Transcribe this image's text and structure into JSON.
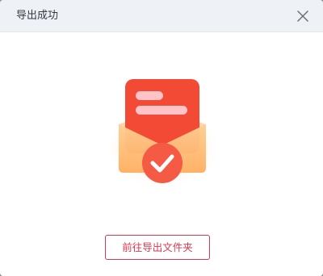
{
  "dialog": {
    "title": "导出成功",
    "close_icon": "close-icon",
    "illustration_icon": "envelope-success-icon",
    "open_folder_label": "前往导出文件夹"
  },
  "colors": {
    "header_bg": "#eef1f5",
    "accent": "#d9384f",
    "card": "#f24a34",
    "envelope": "#ffc07a",
    "check_badge": "#f45a44"
  }
}
